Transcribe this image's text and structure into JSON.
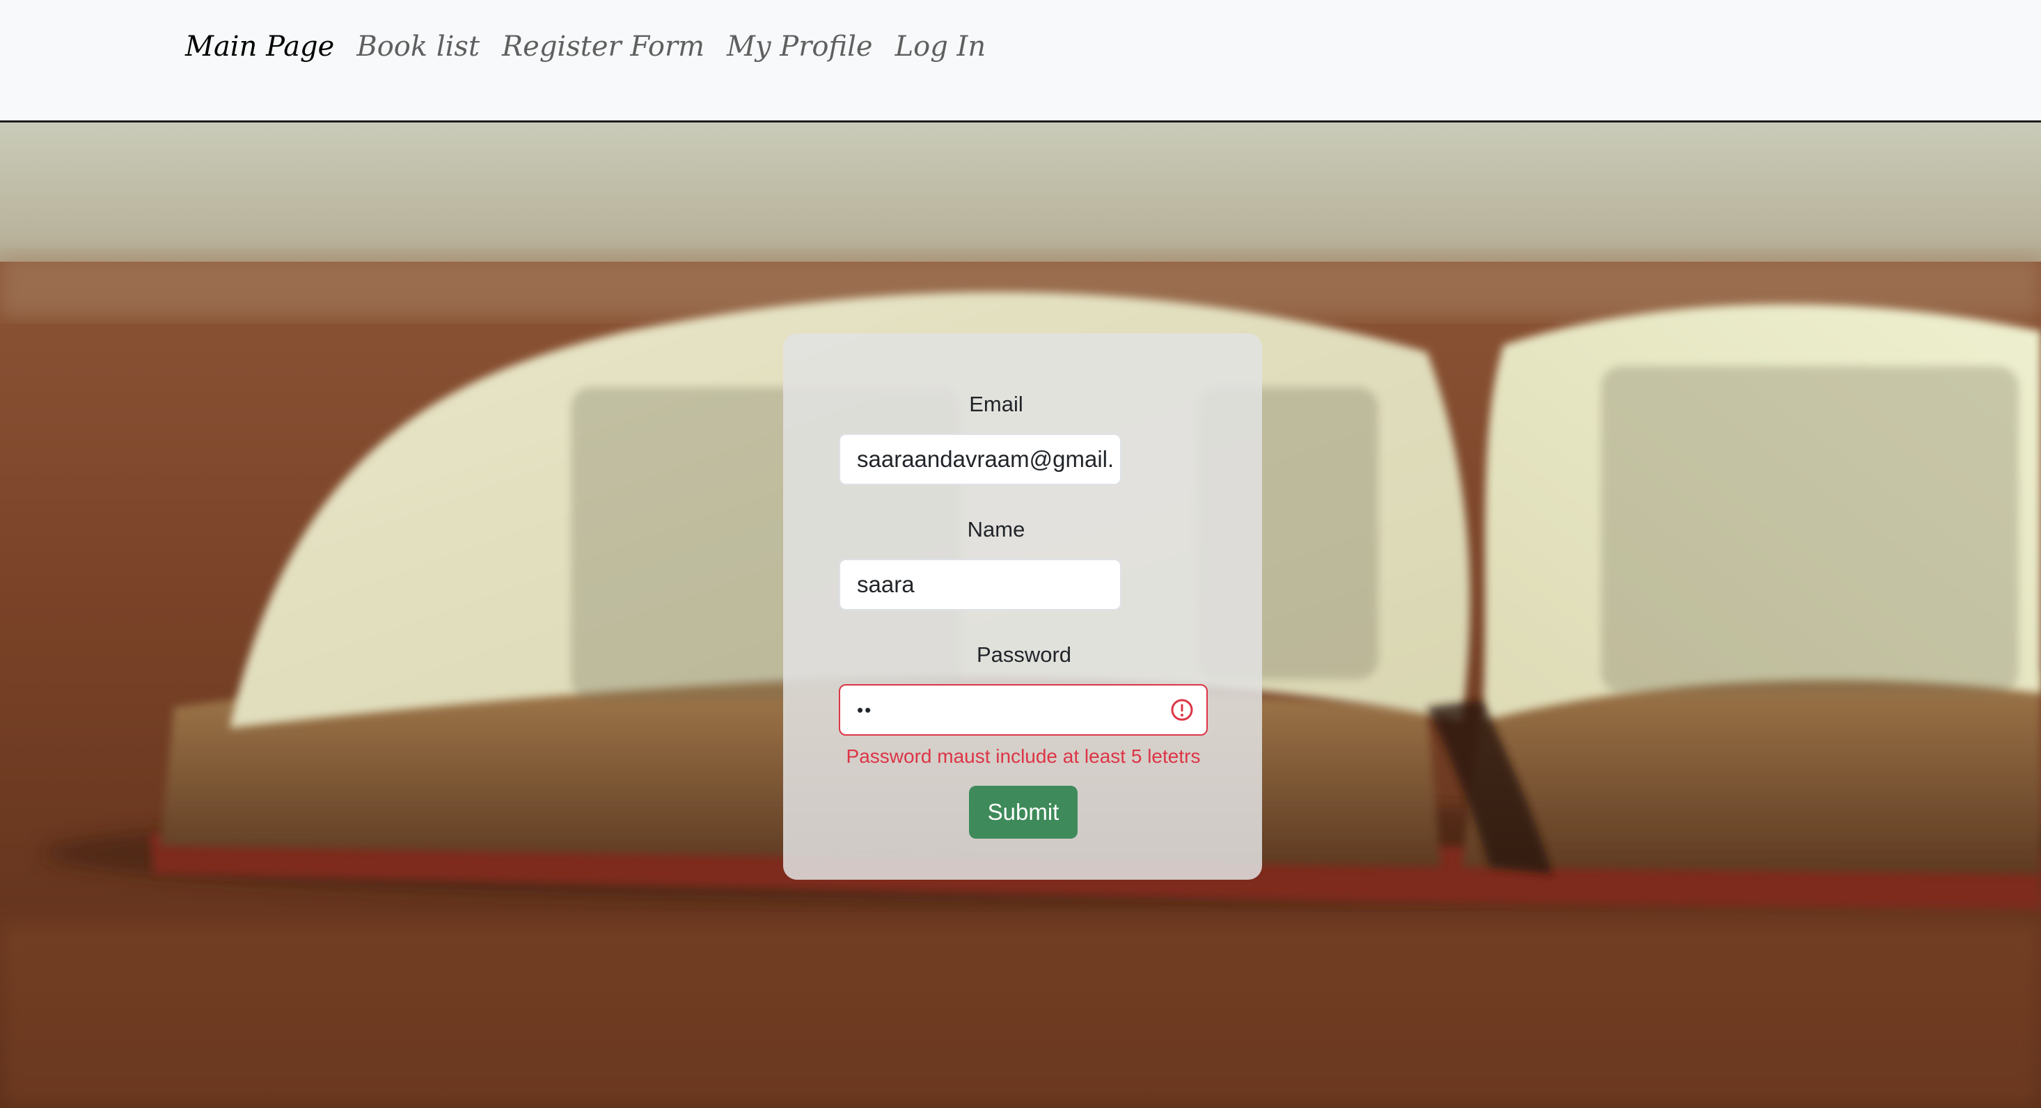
{
  "nav": {
    "items": [
      {
        "label": "Main Page",
        "active": true
      },
      {
        "label": "Book list",
        "active": false
      },
      {
        "label": "Register Form",
        "active": false
      },
      {
        "label": "My Profile",
        "active": false
      },
      {
        "label": "Log In",
        "active": false
      }
    ]
  },
  "form": {
    "email": {
      "label": "Email",
      "value": "saaraandavraam@gmail."
    },
    "name": {
      "label": "Name",
      "value": "saara"
    },
    "password": {
      "label": "Password",
      "masked_value": "••",
      "error": "Password maust include at least 5 letetrs"
    },
    "submit_label": "Submit"
  },
  "colors": {
    "error": "#dc3545",
    "submit": "#3e8a5a",
    "navbar_bg": "#f8f9fa"
  }
}
